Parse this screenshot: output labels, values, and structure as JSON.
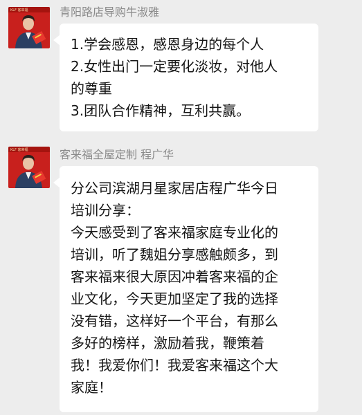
{
  "messages": [
    {
      "sender": "青阳路店导购牛淑雅",
      "avatar_banner": "KLF 客来福",
      "lines": [
        "1.学会感恩，感恩身边的每个人",
        "2.女性出门一定要化淡妆，对他人",
        "的尊重",
        "3.团队合作精神，互利共赢。"
      ]
    },
    {
      "sender": "客来福全屋定制 程广华",
      "avatar_banner": "KLF 客来福",
      "lines": [
        "分公司滨湖月星家居店程广华今日",
        "培训分享：",
        "今天感受到了客来福家庭专业化的",
        "培训，听了魏姐分享感触颇多，到",
        "客来福来很大原因冲着客来福的企",
        "业文化，今天更加坚定了我的选择",
        "没有错，这样好一个平台，有那么",
        "多好的榜样，激励着我，鞭策着",
        "我！我爱你们！我爱客来福这个大",
        "家庭！"
      ]
    }
  ],
  "colors": {
    "background": "#ededed",
    "bubble": "#ffffff",
    "sender_name": "#8a8a8a",
    "avatar_red": "#c8201d"
  }
}
